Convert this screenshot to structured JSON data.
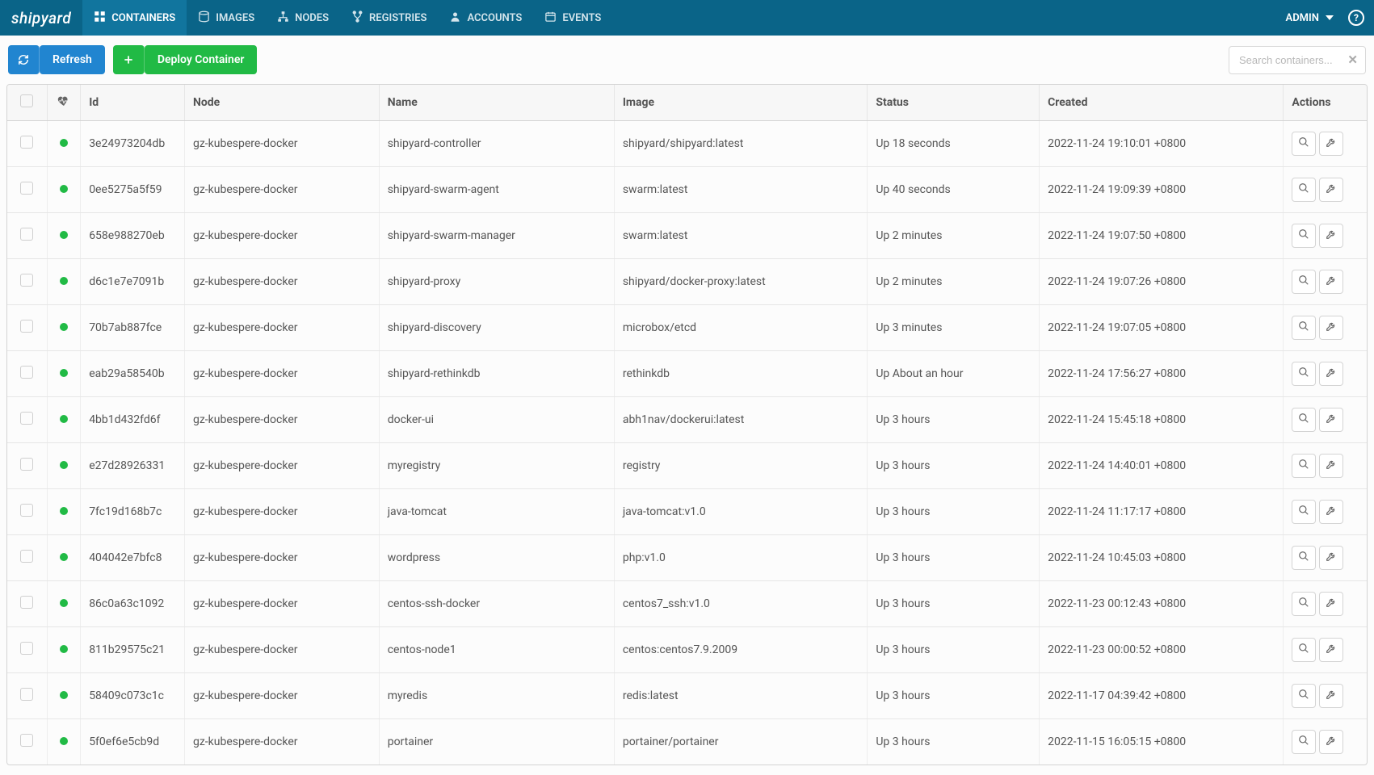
{
  "brand": "shipyard",
  "nav": [
    {
      "label": "CONTAINERS",
      "icon": "grid",
      "active": true
    },
    {
      "label": "IMAGES",
      "icon": "disk",
      "active": false
    },
    {
      "label": "NODES",
      "icon": "sitemap",
      "active": false
    },
    {
      "label": "REGISTRIES",
      "icon": "fork",
      "active": false
    },
    {
      "label": "ACCOUNTS",
      "icon": "user",
      "active": false
    },
    {
      "label": "EVENTS",
      "icon": "calendar",
      "active": false
    }
  ],
  "admin_label": "ADMIN",
  "toolbar": {
    "refresh_label": "Refresh",
    "deploy_label": "Deploy Container",
    "search_placeholder": "Search containers..."
  },
  "columns": {
    "id": "Id",
    "node": "Node",
    "name": "Name",
    "image": "Image",
    "status": "Status",
    "created": "Created",
    "actions": "Actions"
  },
  "rows": [
    {
      "id": "3e24973204db",
      "node": "gz-kubespere-docker",
      "name": "shipyard-controller",
      "image": "shipyard/shipyard:latest",
      "status": "Up 18 seconds",
      "created": "2022-11-24 19:10:01 +0800"
    },
    {
      "id": "0ee5275a5f59",
      "node": "gz-kubespere-docker",
      "name": "shipyard-swarm-agent",
      "image": "swarm:latest",
      "status": "Up 40 seconds",
      "created": "2022-11-24 19:09:39 +0800"
    },
    {
      "id": "658e988270eb",
      "node": "gz-kubespere-docker",
      "name": "shipyard-swarm-manager",
      "image": "swarm:latest",
      "status": "Up 2 minutes",
      "created": "2022-11-24 19:07:50 +0800"
    },
    {
      "id": "d6c1e7e7091b",
      "node": "gz-kubespere-docker",
      "name": "shipyard-proxy",
      "image": "shipyard/docker-proxy:latest",
      "status": "Up 2 minutes",
      "created": "2022-11-24 19:07:26 +0800"
    },
    {
      "id": "70b7ab887fce",
      "node": "gz-kubespere-docker",
      "name": "shipyard-discovery",
      "image": "microbox/etcd",
      "status": "Up 3 minutes",
      "created": "2022-11-24 19:07:05 +0800"
    },
    {
      "id": "eab29a58540b",
      "node": "gz-kubespere-docker",
      "name": "shipyard-rethinkdb",
      "image": "rethinkdb",
      "status": "Up About an hour",
      "created": "2022-11-24 17:56:27 +0800"
    },
    {
      "id": "4bb1d432fd6f",
      "node": "gz-kubespere-docker",
      "name": "docker-ui",
      "image": "abh1nav/dockerui:latest",
      "status": "Up 3 hours",
      "created": "2022-11-24 15:45:18 +0800"
    },
    {
      "id": "e27d28926331",
      "node": "gz-kubespere-docker",
      "name": "myregistry",
      "image": "registry",
      "status": "Up 3 hours",
      "created": "2022-11-24 14:40:01 +0800"
    },
    {
      "id": "7fc19d168b7c",
      "node": "gz-kubespere-docker",
      "name": "java-tomcat",
      "image": "java-tomcat:v1.0",
      "status": "Up 3 hours",
      "created": "2022-11-24 11:17:17 +0800"
    },
    {
      "id": "404042e7bfc8",
      "node": "gz-kubespere-docker",
      "name": "wordpress",
      "image": "php:v1.0",
      "status": "Up 3 hours",
      "created": "2022-11-24 10:45:03 +0800"
    },
    {
      "id": "86c0a63c1092",
      "node": "gz-kubespere-docker",
      "name": "centos-ssh-docker",
      "image": "centos7_ssh:v1.0",
      "status": "Up 3 hours",
      "created": "2022-11-23 00:12:43 +0800"
    },
    {
      "id": "811b29575c21",
      "node": "gz-kubespere-docker",
      "name": "centos-node1",
      "image": "centos:centos7.9.2009",
      "status": "Up 3 hours",
      "created": "2022-11-23 00:00:52 +0800"
    },
    {
      "id": "58409c073c1c",
      "node": "gz-kubespere-docker",
      "name": "myredis",
      "image": "redis:latest",
      "status": "Up 3 hours",
      "created": "2022-11-17 04:39:42 +0800"
    },
    {
      "id": "5f0ef6e5cb9d",
      "node": "gz-kubespere-docker",
      "name": "portainer",
      "image": "portainer/portainer",
      "status": "Up 3 hours",
      "created": "2022-11-15 16:05:15 +0800"
    }
  ]
}
